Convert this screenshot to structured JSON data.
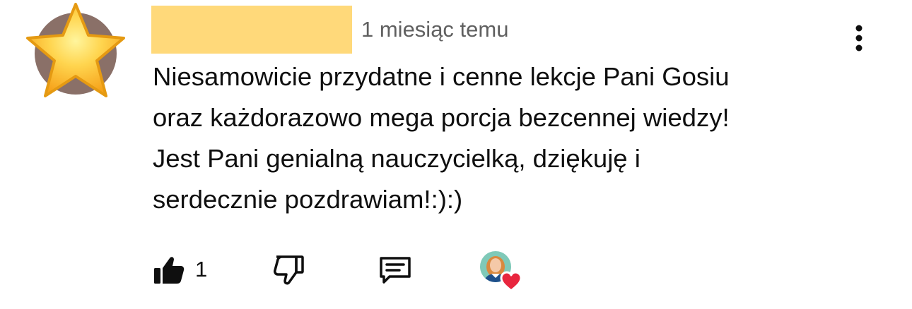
{
  "comment": {
    "author_redacted": true,
    "timestamp": "1 miesiąc temu",
    "text_lines": [
      "Niesamowicie przydatne i cenne lekcje Pani Gosiu",
      "oraz każdorazowo mega porcja bezcennej wiedzy!",
      "Jest Pani genialną nauczycielką, dziękuję i",
      "serdecznie pozdrawiam!:):)"
    ],
    "avatar_icon": "star-emoji-icon",
    "redaction_color": "#ffd97a"
  },
  "actions": {
    "like_icon": "thumbs-up-icon",
    "like_count": "1",
    "dislike_icon": "thumbs-down-icon",
    "reply_icon": "comment-reply-icon",
    "more_icon": "more-vertical-icon",
    "creator_heart_icon": "creator-heart-badge-icon"
  },
  "colors": {
    "text_primary": "#0f0f0f",
    "text_secondary": "#606060",
    "heart": "#e8263e",
    "avatar_bg": "#8a7068"
  }
}
